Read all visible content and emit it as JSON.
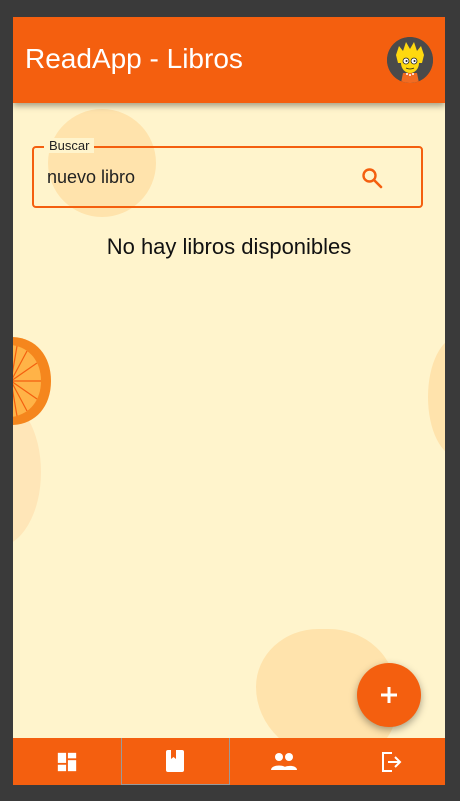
{
  "appbar": {
    "title": "ReadApp - Libros",
    "avatar_icon": "lisa-simpson-avatar-icon"
  },
  "search": {
    "label": "Buscar",
    "value": "nuevo libro",
    "icon": "search-icon"
  },
  "content": {
    "empty_message": "No hay libros disponibles"
  },
  "fab": {
    "icon": "plus-icon"
  },
  "bottom_nav": {
    "items": [
      {
        "icon": "dashboard-icon",
        "active": false
      },
      {
        "icon": "book-icon",
        "active": true
      },
      {
        "icon": "people-icon",
        "active": false
      },
      {
        "icon": "logout-icon",
        "active": false
      }
    ]
  },
  "colors": {
    "primary": "#f45f0f",
    "background": "#fff4cc",
    "blob": "#ffe3ac",
    "frame": "#3a3a3a"
  }
}
